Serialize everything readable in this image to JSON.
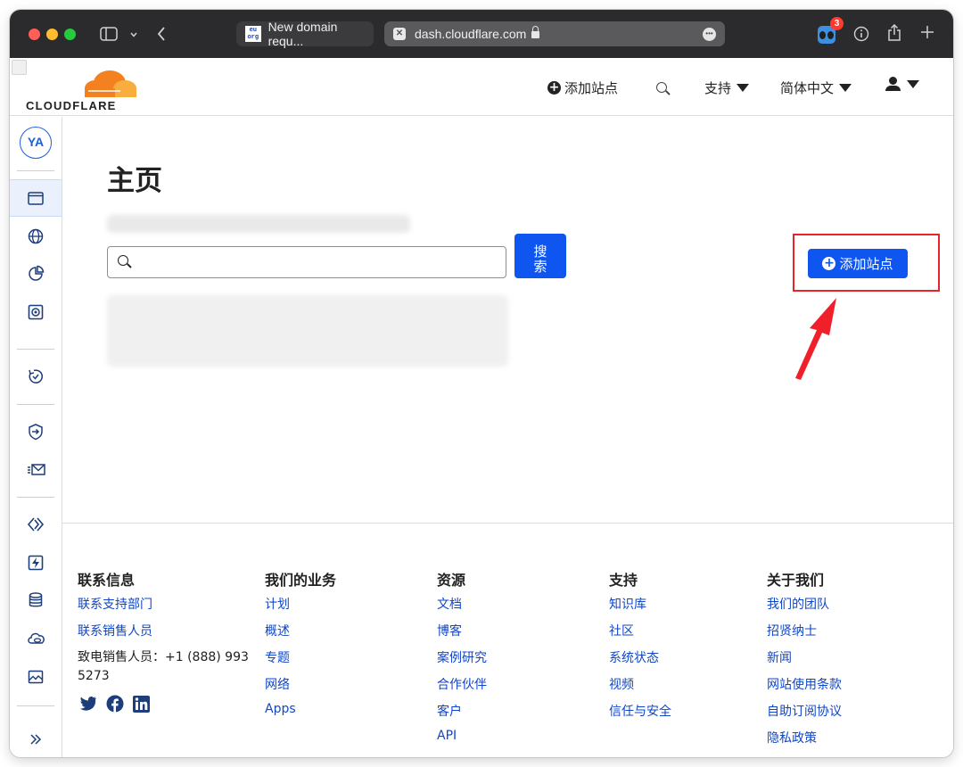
{
  "browser": {
    "tabs": [
      {
        "favicon": "eu\norg",
        "label": "New domain requ..."
      },
      {
        "label": "dash.cloudflare.com"
      }
    ],
    "extension_badge": "3"
  },
  "header": {
    "logo_text": "CLOUDFLARE",
    "add_site": "添加站点",
    "support": "支持",
    "language": "简体中文"
  },
  "sidebar": {
    "avatar": "YA",
    "icons": [
      "websites-icon",
      "globe-icon",
      "analytics-icon",
      "security-center-icon",
      "trace-icon",
      "zero-trust-icon",
      "email-icon",
      "workers-icon",
      "pages-icon",
      "storage-icon",
      "r2-cloud-icon",
      "images-icon",
      "expand-icon"
    ]
  },
  "main": {
    "title": "主页",
    "search": {
      "placeholder": "",
      "button": "搜\n索"
    },
    "add_site_button": "添加站点"
  },
  "footer": {
    "contact": {
      "heading": "联系信息",
      "links": [
        "联系支持部门",
        "联系销售人员"
      ],
      "phone": "致电销售人员：+1 (888) 993 5273"
    },
    "business": {
      "heading": "我们的业务",
      "links": [
        "计划",
        "概述",
        "专题",
        "网络",
        "Apps"
      ]
    },
    "resources": {
      "heading": "资源",
      "links": [
        "文档",
        "博客",
        "案例研究",
        "合作伙伴",
        "客户",
        "API"
      ]
    },
    "support": {
      "heading": "支持",
      "links": [
        "知识库",
        "社区",
        "系统状态",
        "视频",
        "信任与安全"
      ]
    },
    "about": {
      "heading": "关于我们",
      "links": [
        "我们的团队",
        "招贤纳士",
        "新闻",
        "网站使用条款",
        "自助订阅协议",
        "隐私政策"
      ]
    }
  },
  "colors": {
    "brand_blue": "#0f55f0",
    "link_blue": "#1046c7",
    "highlight_red": "#e8232a",
    "cloudflare_orange": "#f48120"
  }
}
